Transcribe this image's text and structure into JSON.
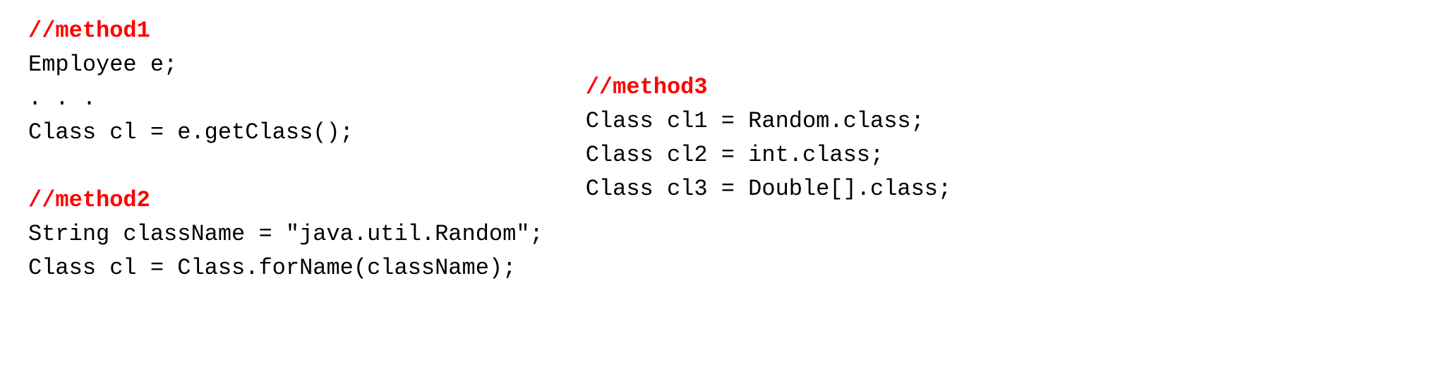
{
  "left": {
    "method1_comment": "//method1",
    "line1": "Employee e;",
    "line2": ". . .",
    "line3": "Class cl = e.getClass();",
    "method2_comment": "//method2",
    "line4": "String className = \"java.util.Random\";",
    "line5": "Class cl = Class.forName(className);"
  },
  "right": {
    "method3_comment": "//method3",
    "line1": "Class cl1 = Random.class;",
    "line2": "Class cl2 = int.class;",
    "line3": "Class cl3 = Double[].class;"
  }
}
